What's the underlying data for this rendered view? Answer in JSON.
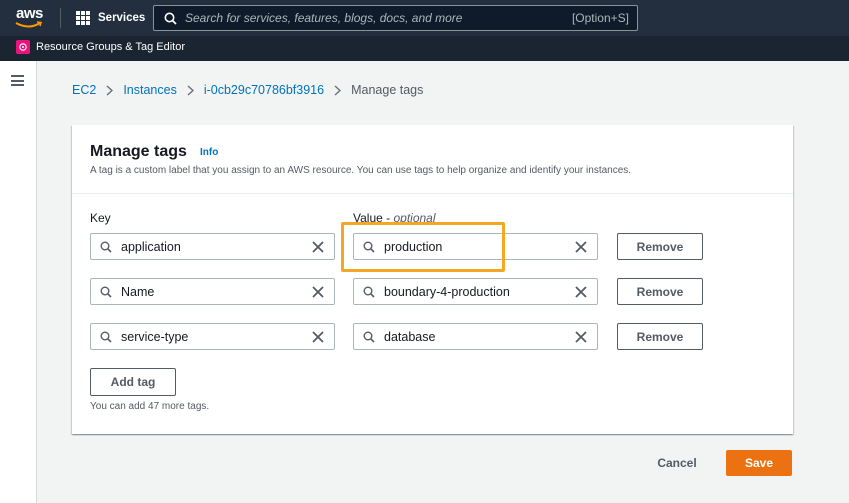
{
  "topnav": {
    "logo_text": "aws",
    "services_label": "Services",
    "search_placeholder": "Search for services, features, blogs, docs, and more",
    "search_shortcut": "[Option+S]"
  },
  "subnav": {
    "resource_groups_label": "Resource Groups & Tag Editor"
  },
  "breadcrumb": {
    "items": [
      "EC2",
      "Instances",
      "i-0cb29c70786bf3916"
    ],
    "current": "Manage tags"
  },
  "panel": {
    "title": "Manage tags",
    "info_label": "Info",
    "description": "A tag is a custom label that you assign to an AWS resource. You can use tags to help organize and identify your instances.",
    "key_label": "Key",
    "value_label": "Value - ",
    "value_optional": "optional",
    "tags": [
      {
        "key": "application",
        "value": "production"
      },
      {
        "key": "Name",
        "value": "boundary-4-production"
      },
      {
        "key": "service-type",
        "value": "database"
      }
    ],
    "remove_label": "Remove",
    "add_tag_label": "Add tag",
    "hint": "You can add 47 more tags."
  },
  "footer": {
    "cancel_label": "Cancel",
    "save_label": "Save"
  },
  "colors": {
    "nav_bg": "#232f3e",
    "link": "#0073bb",
    "primary": "#ec7211",
    "highlight": "#f5a623",
    "resource_groups_icon": "#e7157b"
  }
}
